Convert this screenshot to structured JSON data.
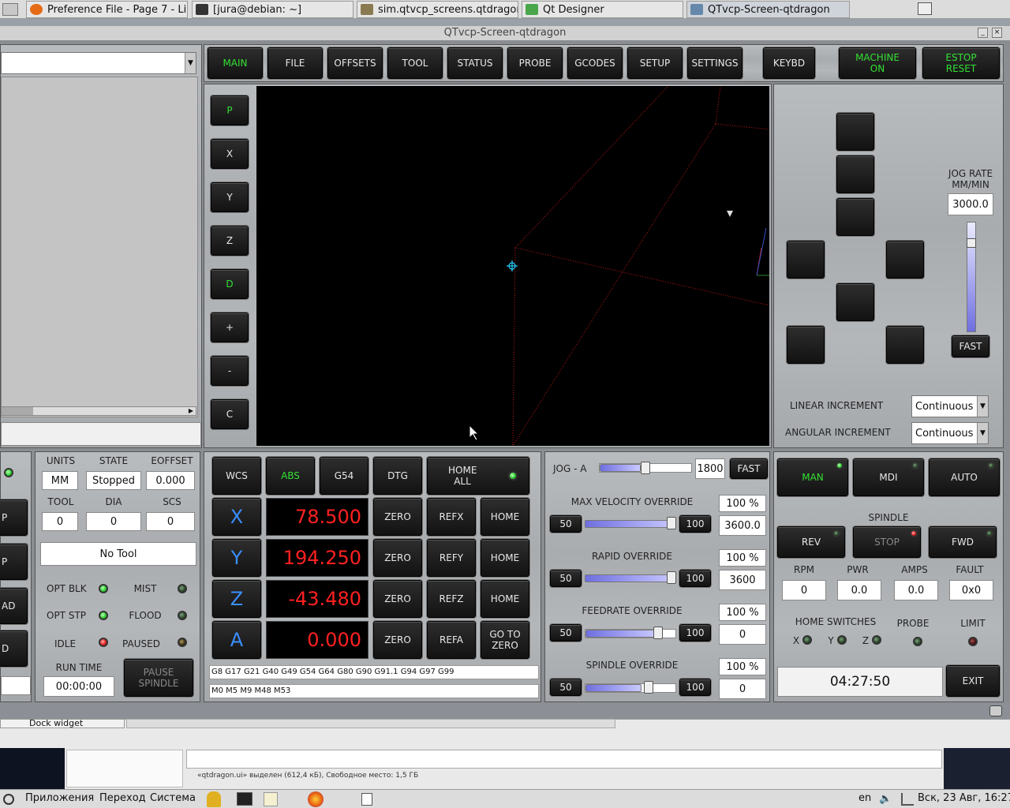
{
  "taskbar": {
    "tabs": [
      {
        "label": "Preference File - Page 7 - Li...",
        "color": "#e66b16"
      },
      {
        "label": "[jura@debian: ~]",
        "color": "#333333"
      },
      {
        "label": "sim.qtvcp_screens.qtdragon",
        "color": "#8a7a50"
      },
      {
        "label": "Qt Designer",
        "color": "#4aa64a"
      },
      {
        "label": "QTvcp-Screen-qtdragon",
        "color": "#6688aa"
      }
    ]
  },
  "window": {
    "title": "QTvcp-Screen-qtdragon"
  },
  "nav": {
    "tabs": [
      "MAIN",
      "FILE",
      "OFFSETS",
      "TOOL",
      "STATUS",
      "PROBE",
      "GCODES",
      "SETUP",
      "SETTINGS",
      "KEYBD"
    ],
    "machine_on": "MACHINE ON",
    "estop": "ESTOP RESET"
  },
  "view_buttons": [
    "P",
    "X",
    "Y",
    "Z",
    "D",
    "+",
    "-",
    "C"
  ],
  "jog": {
    "rate_label": "JOG RATE MM/MIN",
    "rate_value": "3000.0",
    "fast_label": "FAST",
    "linear_increment_label": "LINEAR INCREMENT",
    "linear_increment_value": "Continuous",
    "angular_increment_label": "ANGULAR INCREMENT",
    "angular_increment_value": "Continuous"
  },
  "status": {
    "units_label": "UNITS",
    "units_value": "MM",
    "state_label": "STATE",
    "state_value": "Stopped",
    "eoffset_label": "EOFFSET",
    "eoffset_value": "0.000",
    "tool_label": "TOOL",
    "tool_value": "0",
    "dia_label": "DIA",
    "dia_value": "0",
    "scs_label": "SCS",
    "scs_value": "0",
    "tool_name": "No Tool",
    "opt_blk": "OPT BLK",
    "mist": "MIST",
    "opt_stp": "OPT STP",
    "flood": "FLOOD",
    "idle": "IDLE",
    "paused": "PAUSED",
    "run_time_label": "RUN TIME",
    "run_time_value": "00:00:00",
    "pause_spindle": "PAUSE SPINDLE"
  },
  "left_edge_buttons": [
    "P",
    "P",
    "AD",
    "D"
  ],
  "dro": {
    "wcs": "WCS",
    "abs": "ABS",
    "g54": "G54",
    "dtg": "DTG",
    "home_all": "HOME ALL",
    "axes": [
      {
        "name": "X",
        "value": "78.500",
        "zero": "ZERO",
        "ref": "REFX",
        "home": "HOME"
      },
      {
        "name": "Y",
        "value": "194.250",
        "zero": "ZERO",
        "ref": "REFY",
        "home": "HOME"
      },
      {
        "name": "Z",
        "value": "-43.480",
        "zero": "ZERO",
        "ref": "REFZ",
        "home": "HOME"
      },
      {
        "name": "A",
        "value": "0.000",
        "zero": "ZERO",
        "ref": "REFA",
        "home": "GO TO ZERO"
      }
    ],
    "gcodes": "G8 G17 G21 G40 G49 G54 G64 G80 G90 G91.1 G94 G97 G99",
    "mcodes": "M0 M5 M9 M48 M53"
  },
  "overrides": {
    "jog_a_label": "JOG - A",
    "jog_a_value": "1800",
    "jog_a_level": 0.45,
    "jog_a_fast": "FAST",
    "items": [
      {
        "label": "MAX VELOCITY OVERRIDE",
        "pct": "100 %",
        "value": "3600.0",
        "min": "50",
        "max": "100",
        "level": 1.0
      },
      {
        "label": "RAPID OVERRIDE",
        "pct": "100 %",
        "value": "3600",
        "min": "50",
        "max": "100",
        "level": 1.0
      },
      {
        "label": "FEEDRATE OVERRIDE",
        "pct": "100 %",
        "value": "0",
        "min": "50",
        "max": "100",
        "level": 0.8
      },
      {
        "label": "SPINDLE OVERRIDE",
        "pct": "100 %",
        "value": "0",
        "min": "50",
        "max": "100",
        "level": 0.6
      }
    ]
  },
  "mode": {
    "man": "MAN",
    "mdi": "MDI",
    "auto": "AUTO",
    "spindle_label": "SPINDLE",
    "rev": "REV",
    "stop": "STOP",
    "fwd": "FWD",
    "rpm_label": "RPM",
    "rpm_value": "0",
    "pwr_label": "PWR",
    "pwr_value": "0.0",
    "amps_label": "AMPS",
    "amps_value": "0.0",
    "fault_label": "FAULT",
    "fault_value": "0x0",
    "home_switches_label": "HOME SWITCHES",
    "probe_label": "PROBE",
    "limit_label": "LIMIT",
    "sw_x": "X",
    "sw_y": "Y",
    "sw_z": "Z",
    "clock": "04:27:50",
    "exit": "EXIT"
  },
  "designer": {
    "dock_label": "Dock widget",
    "status_text": "«qtdragon.ui» выделен (612,4 кБ), Свободное место: 1,5 ГБ"
  },
  "system_panel": {
    "apps": "Приложения",
    "go": "Переход",
    "system": "Система",
    "lang": "en",
    "datetime": "Вск, 23 Авг, 16:27"
  }
}
